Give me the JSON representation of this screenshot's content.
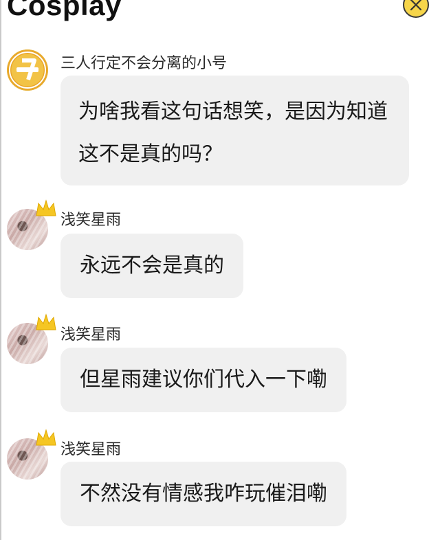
{
  "header": {
    "title": "Cosplay",
    "close_icon": "close-x-icon"
  },
  "messages": [
    {
      "sender": "三人行定不会分离的小号",
      "avatar": "tfboys-logo",
      "text": "为啥我看这句话想笑，是因为知道这不是真的吗？"
    },
    {
      "sender": "浅笑星雨",
      "avatar": "user-photo-crown",
      "text": "永远不会是真的"
    },
    {
      "sender": "浅笑星雨",
      "avatar": "user-photo-crown",
      "text": "但星雨建议你们代入一下嘞"
    },
    {
      "sender": "浅笑星雨",
      "avatar": "user-photo-crown",
      "text": "不然没有情感我咋玩催泪嘞"
    }
  ],
  "colors": {
    "bubble": "#f0f0f0",
    "close_button": "#f6d54a",
    "crown": "#f5c623",
    "logo": "#f2c346"
  }
}
